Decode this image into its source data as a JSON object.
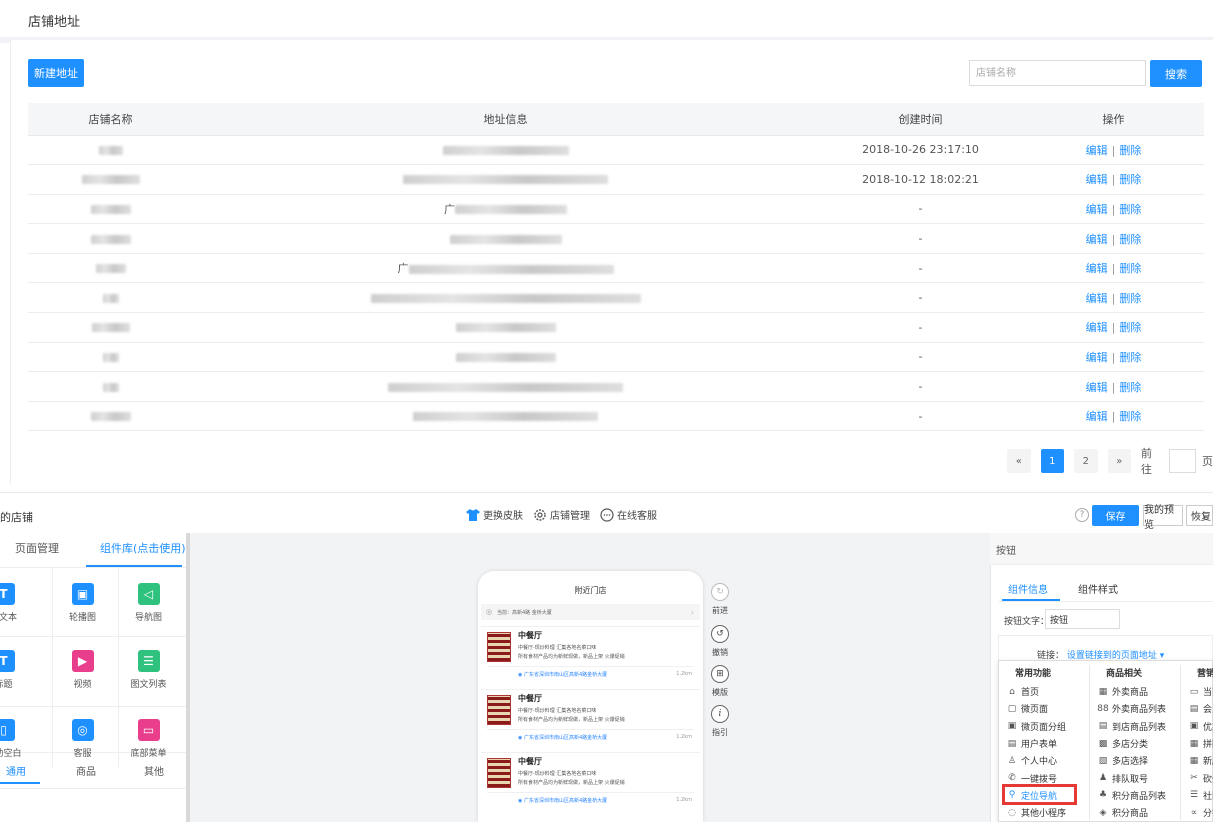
{
  "top": {
    "title": "店铺地址",
    "new_button": "新建地址",
    "search_placeholder": "店铺名称",
    "search_button": "搜索",
    "columns": [
      "店铺名称",
      "地址信息",
      "创建时间",
      "操作"
    ],
    "rows": [
      {
        "time": "2018-10-26 23:17:10"
      },
      {
        "time": "2018-10-12 18:02:21"
      },
      {
        "time": "-"
      },
      {
        "time": "-"
      },
      {
        "time": "-"
      },
      {
        "time": "-"
      },
      {
        "time": "-"
      },
      {
        "time": "-"
      },
      {
        "time": "-"
      },
      {
        "time": "-"
      }
    ],
    "row_prefix_3": "广",
    "row_prefix_5": "广",
    "edit_label": "编辑",
    "delete_label": "删除",
    "op_sep": "|",
    "pager": {
      "prev": "«",
      "pages": [
        "1",
        "2"
      ],
      "next": "»",
      "goto": "前往",
      "page_unit": "页",
      "current": "1"
    }
  },
  "editor": {
    "left_title": "的店铺",
    "toolbar": {
      "skin": "更换皮肤",
      "shop_manage": "店铺管理",
      "service": "在线客服"
    },
    "save": "保存",
    "preview": "我的预览",
    "restore": "恢复",
    "help": "?",
    "left_tabs": {
      "page_manage": "页面管理",
      "components": "组件库(点击使用)"
    },
    "components": [
      {
        "label": "富文本",
        "icon": "text-icon",
        "color": "#1e90ff",
        "glyph": "T"
      },
      {
        "label": "轮播图",
        "icon": "carousel-icon",
        "color": "#1e90ff",
        "glyph": "▣"
      },
      {
        "label": "导航图",
        "icon": "nav-icon",
        "color": "#2ec27e",
        "glyph": "◁"
      },
      {
        "label": "标题",
        "icon": "title-icon",
        "color": "#1e90ff",
        "glyph": "T"
      },
      {
        "label": "视频",
        "icon": "video-icon",
        "color": "#e83e8c",
        "glyph": "▶"
      },
      {
        "label": "图文列表",
        "icon": "list-icon",
        "color": "#2ec27e",
        "glyph": "☰"
      },
      {
        "label": "辅助空白",
        "icon": "blank-icon",
        "color": "#1e90ff",
        "glyph": "▯"
      },
      {
        "label": "客服",
        "icon": "headset-icon",
        "color": "#1e90ff",
        "glyph": "◎"
      },
      {
        "label": "底部菜单",
        "icon": "menu-icon",
        "color": "#e83e8c",
        "glyph": "▭"
      }
    ],
    "bottom_tabs": {
      "common": "通用",
      "goods": "商品",
      "other": "其他"
    },
    "phone": {
      "header": "附近门店",
      "location": "当前：高新4路 金桥大厦",
      "cards": [
        {
          "name": "中餐厅",
          "d1": "中餐厅-现炒料理  汇集各地名菜口味",
          "d2": "所有食材产品均为新鲜现做，新品上架  火爆促销",
          "addr": "广东省深圳市南山区高新4路金桥大厦",
          "dist": "1.2km"
        },
        {
          "name": "中餐厅",
          "d1": "中餐厅-现炒料理  汇集各地名菜口味",
          "d2": "所有食材产品均为新鲜现做，新品上架  火爆促销",
          "addr": "广东省深圳市南山区高新4路金桥大厦",
          "dist": "1.2km"
        },
        {
          "name": "中餐厅",
          "d1": "中餐厅-现炒料理  汇集各地名菜口味",
          "d2": "所有食材产品均为新鲜现做，新品上架  火爆促销",
          "addr": "广东省深圳市南山区高新4路金桥大厦",
          "dist": "1.2km"
        }
      ]
    },
    "side_tools": {
      "redo": "前进",
      "undo": "撤销",
      "template": "模版",
      "guide": "指引"
    },
    "right": {
      "header": "按钮",
      "tab_info": "组件信息",
      "tab_style": "组件样式",
      "button_text_label": "按钮文字：",
      "button_text_value": "按钮",
      "link_label": "链接：",
      "link_value": "设置链接到的页面地址 ▾",
      "dropdown": {
        "col1": {
          "header": "常用功能",
          "items": [
            "首页",
            "微页面",
            "微页面分组",
            "用户表单",
            "个人中心",
            "一键拨号",
            "定位导航",
            "其他小程序"
          ]
        },
        "col2": {
          "header": "商品相关",
          "items": [
            "外卖商品",
            "外卖商品列表",
            "到店商品列表",
            "多店分类",
            "多店选择",
            "排队取号",
            "积分商品列表",
            "积分商品"
          ]
        },
        "col3": {
          "header": "营销",
          "items": [
            "当面",
            "会员",
            "优惠",
            "拼团",
            "新版",
            "砍价",
            "社区",
            "分销"
          ]
        }
      },
      "highlighted_item": "定位导航"
    }
  }
}
